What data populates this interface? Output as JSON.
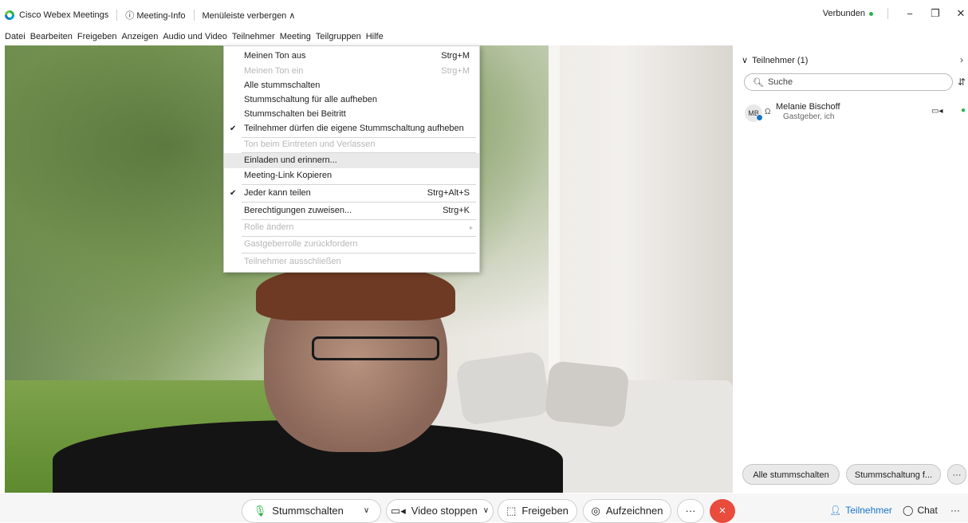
{
  "titlebar": {
    "app_name": "Cisco Webex Meetings",
    "meeting_info": "Meeting-Info",
    "hide_menu": "Menüleiste verbergen",
    "status": "Verbunden"
  },
  "menubar": [
    "Datei",
    "Bearbeiten",
    "Freigeben",
    "Anzeigen",
    "Audio und Video",
    "Teilnehmer",
    "Meeting",
    "Teilgruppen",
    "Hilfe"
  ],
  "dropdown": {
    "items": [
      {
        "label": "Meinen Ton aus",
        "shortcut": "Strg+M",
        "enabled": true,
        "checked": false
      },
      {
        "label": "Meinen Ton ein",
        "shortcut": "Strg+M",
        "enabled": false,
        "checked": false
      },
      {
        "label": "Alle stummschalten",
        "shortcut": "",
        "enabled": true,
        "checked": false
      },
      {
        "label": "Stummschaltung für alle aufheben",
        "shortcut": "",
        "enabled": true,
        "checked": false
      },
      {
        "label": "Stummschalten bei Beitritt",
        "shortcut": "",
        "enabled": true,
        "checked": false
      },
      {
        "label": "Teilnehmer dürfen die eigene Stummschaltung aufheben",
        "shortcut": "",
        "enabled": true,
        "checked": true
      },
      {
        "label": "Ton beim Eintreten und Verlassen",
        "shortcut": "",
        "enabled": false,
        "checked": false
      },
      {
        "label": "Einladen und erinnern...",
        "shortcut": "",
        "enabled": true,
        "checked": false,
        "highlight": true
      },
      {
        "label": "Meeting-Link Kopieren",
        "shortcut": "",
        "enabled": true,
        "checked": false
      },
      {
        "label": "Jeder kann teilen",
        "shortcut": "Strg+Alt+S",
        "enabled": true,
        "checked": true
      },
      {
        "label": "Berechtigungen zuweisen...",
        "shortcut": "Strg+K",
        "enabled": true,
        "checked": false
      },
      {
        "label": "Rolle ändern",
        "shortcut": "",
        "enabled": false,
        "checked": false,
        "submenu": true
      },
      {
        "label": "Gastgeberrolle zurückfordern",
        "shortcut": "",
        "enabled": false,
        "checked": false
      },
      {
        "label": "Teilnehmer ausschließen",
        "shortcut": "",
        "enabled": false,
        "checked": false
      }
    ],
    "check_glyph": "✔"
  },
  "panel": {
    "title": "Teilnehmer (1)",
    "search_placeholder": "Suche",
    "attendee": {
      "initials": "MB",
      "name": "Melanie Bischoff",
      "role": "Gastgeber, ich"
    },
    "mute_all": "Alle stummschalten",
    "unmute_all": "Stummschaltung f...",
    "more": "···"
  },
  "controls": {
    "mute": "Stummschalten",
    "video": "Video stoppen",
    "share": "Freigeben",
    "record": "Aufzeichnen",
    "more": "···",
    "end": "×",
    "participants": "Teilnehmer",
    "chat": "Chat",
    "more_right": "···"
  },
  "colors": {
    "accent": "#1475c8",
    "connected": "#2bb24c",
    "end_call": "#e94b3c"
  }
}
